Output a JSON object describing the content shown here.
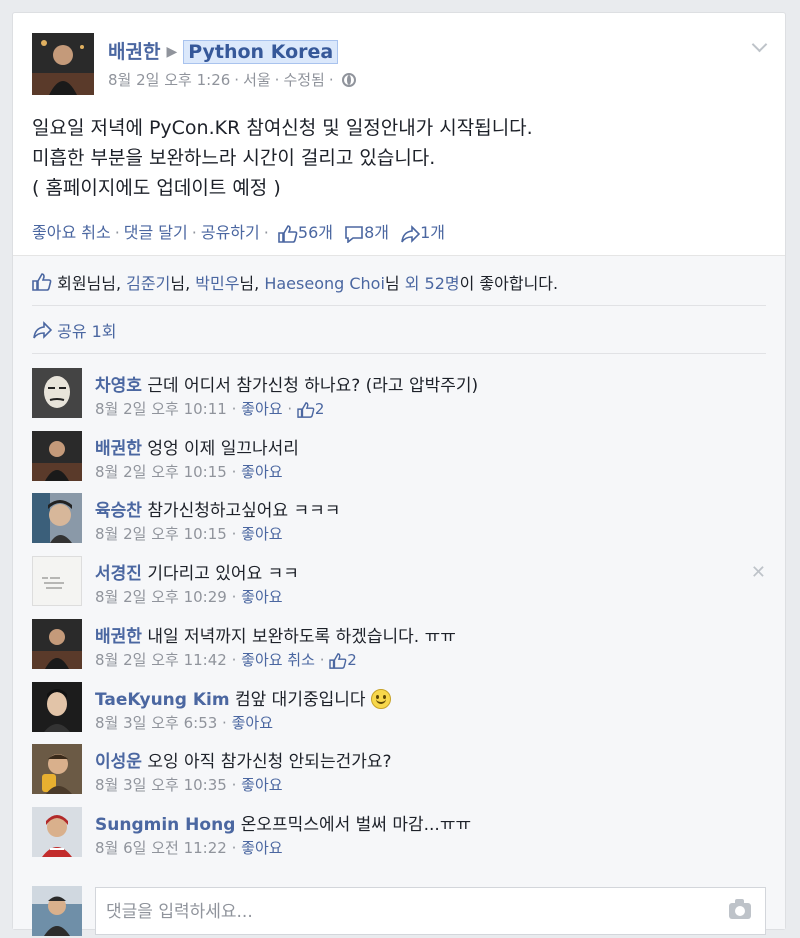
{
  "post": {
    "author": "배권한",
    "group": "Python Korea",
    "date": "8월 2일 오후 1:26",
    "location": "서울",
    "edited": "수정됨",
    "lines": [
      "일요일 저녁에 PyCon.KR 참여신청 및 일정안내가 시작됩니다.",
      "미흡한 부분을 보완하느라 시간이 걸리고 있습니다.",
      "( 홈페이지에도 업데이트 예정 )"
    ],
    "actions": {
      "like": "좋아요 취소",
      "comment": "댓글 달기",
      "share": "공유하기",
      "like_count": "56개",
      "comment_count": "8개",
      "share_count": "1개"
    }
  },
  "likes": {
    "names": [
      "회원님",
      "김준기",
      "박민우",
      "Haeseong Choi"
    ],
    "suffix": "님",
    "others": "외 52명",
    "ending": "이 좋아합니다."
  },
  "shares": {
    "label": "공유 1회"
  },
  "comments": [
    {
      "name": "차영호",
      "text": "근데 어디서 참가신청 하나요? (라고 압박주기)",
      "time": "8월 2일 오후 10:11",
      "action": "좋아요",
      "likes": "2"
    },
    {
      "name": "배권한",
      "text": "엉엉 이제 일끄나서리",
      "time": "8월 2일 오후 10:15",
      "action": "좋아요",
      "likes": ""
    },
    {
      "name": "육승찬",
      "text": "참가신청하고싶어요 ㅋㅋㅋ",
      "time": "8월 2일 오후 10:15",
      "action": "좋아요",
      "likes": ""
    },
    {
      "name": "서경진",
      "text": "기다리고 있어요 ㅋㅋ",
      "time": "8월 2일 오후 10:29",
      "action": "좋아요",
      "likes": ""
    },
    {
      "name": "배권한",
      "text": "내일 저녁까지 보완하도록 하겠습니다. ㅠㅠ",
      "time": "8월 2일 오후 11:42",
      "action": "좋아요 취소",
      "likes": "2"
    },
    {
      "name": "TaeKyung Kim",
      "text": "컴앞 대기중입니다",
      "time": "8월 3일 오후 6:53",
      "action": "좋아요",
      "likes": ""
    },
    {
      "name": "이성운",
      "text": "오잉 아직 참가신청 안되는건가요?",
      "time": "8월 3일 오후 10:35",
      "action": "좋아요",
      "likes": ""
    },
    {
      "name": "Sungmin Hong",
      "text": "온오프믹스에서 벌써 마감...ㅠㅠ",
      "time": "8월 6일 오전 11:22",
      "action": "좋아요",
      "likes": ""
    }
  ],
  "reply": {
    "placeholder": "댓글을 입력하세요..."
  },
  "colors": {
    "link": "#4b67a1",
    "meta": "#90949c",
    "ufi_bg": "#f6f7f9"
  },
  "icons": [
    "chevron-down-icon",
    "globe-icon",
    "like-icon",
    "comment-icon",
    "share-icon",
    "close-icon",
    "smiley-emoji",
    "camera-icon"
  ]
}
